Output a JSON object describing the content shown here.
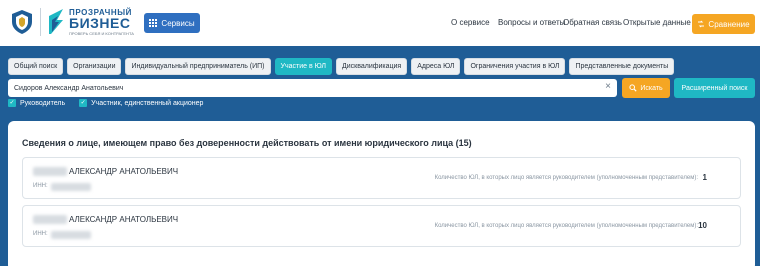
{
  "header": {
    "logo_top": "ПРОЗРАЧНЫЙ",
    "logo_main": "БИЗНЕС",
    "logo_tagline": "ПРОВЕРЬ СЕБЯ И КОНТРАГЕНТА",
    "services_label": "Сервисы",
    "nav": [
      "О сервисе",
      "Вопросы и ответы",
      "Обратная связь",
      "Открытые данные"
    ],
    "compare_label": "Сравнение"
  },
  "tabs": [
    {
      "label": "Общий поиск",
      "active": false
    },
    {
      "label": "Организации",
      "active": false
    },
    {
      "label": "Индивидуальный предприниматель (ИП)",
      "active": false
    },
    {
      "label": "Участие в ЮЛ",
      "active": true
    },
    {
      "label": "Дисквалификация",
      "active": false
    },
    {
      "label": "Адреса ЮЛ",
      "active": false
    },
    {
      "label": "Ограничения участия в ЮЛ",
      "active": false
    },
    {
      "label": "Представленные документы",
      "active": false
    }
  ],
  "search": {
    "value": "Сидоров Александр Анатольевич",
    "search_label": "Искать",
    "advanced_label": "Расширенный поиск"
  },
  "filters": [
    {
      "label": "Руководитель",
      "checked": true
    },
    {
      "label": "Участник, единственный акционер",
      "checked": true
    }
  ],
  "results": {
    "title": "Сведения о лице, имеющем право без доверенности действовать от имени юридического лица (15)",
    "items": [
      {
        "name": "АЛЕКСАНДР АНАТОЛЬЕВИЧ",
        "inn_label": "ИНН:",
        "count_label": "Количество ЮЛ, в которых лицо является руководителем (уполномоченным представителем):",
        "count": "1"
      },
      {
        "name": "АЛЕКСАНДР АНАТОЛЬЕВИЧ",
        "inn_label": "ИНН:",
        "count_label": "Количество ЮЛ, в которых лицо является руководителем (уполномоченным представителем):",
        "count": "10"
      }
    ]
  },
  "colors": {
    "background": "#1f5d96",
    "accent_teal": "#1fb8c4",
    "accent_orange": "#f5a623",
    "primary_blue": "#2f6fc0"
  }
}
